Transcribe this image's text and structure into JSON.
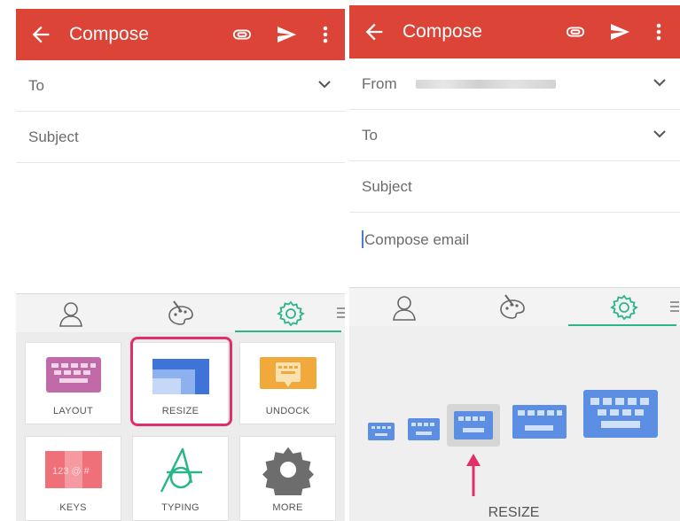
{
  "colors": {
    "topbar": "#db4437",
    "accent_green": "#2bb58a",
    "highlight": "#e0306a",
    "keyboard_blue": "#5c8ee3"
  },
  "left": {
    "topbar": {
      "title": "Compose",
      "icons": [
        "back-arrow-icon",
        "attachment-icon",
        "send-icon",
        "more-vert-icon"
      ]
    },
    "fields": {
      "to_label": "To",
      "subject_placeholder": "Subject"
    },
    "keyboard": {
      "tabs": [
        "contact-icon",
        "theme-palette-icon",
        "settings-gear-icon"
      ],
      "tiles": [
        {
          "label": "LAYOUT",
          "icon": "keyboard-layout-icon"
        },
        {
          "label": "RESIZE",
          "icon": "resize-icon"
        },
        {
          "label": "UNDOCK",
          "icon": "undock-keyboard-icon"
        },
        {
          "label": "KEYS",
          "icon": "keys-icon"
        },
        {
          "label": "TYPING",
          "icon": "typing-swipe-icon"
        },
        {
          "label": "MORE",
          "icon": "more-gear-icon"
        }
      ],
      "keys_tile_glyphs": "123 @ #"
    }
  },
  "right": {
    "topbar": {
      "title": "Compose",
      "icons": [
        "back-arrow-icon",
        "attachment-icon",
        "send-icon",
        "more-vert-icon"
      ]
    },
    "fields": {
      "from_label": "From",
      "to_label": "To",
      "subject_placeholder": "Subject",
      "body_placeholder": "Compose email"
    },
    "keyboard": {
      "tabs": [
        "contact-icon",
        "theme-palette-icon",
        "settings-gear-icon"
      ],
      "size_options": 5,
      "selected_size": 3,
      "resize_label": "RESIZE"
    }
  }
}
